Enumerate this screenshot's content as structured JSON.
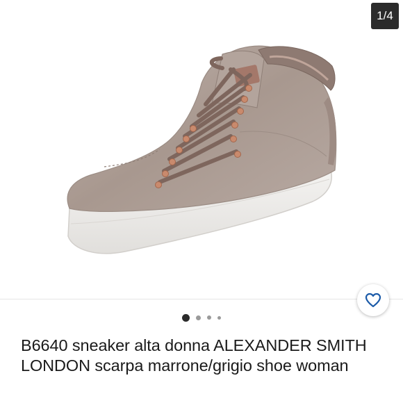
{
  "gallery": {
    "counter": "1/4",
    "dots_count": 4,
    "active_index": 0
  },
  "listing": {
    "title": "B6640 sneaker alta donna ALEXANDER SMITH LONDON scarpa marrone/grigio shoe woman"
  },
  "icons": {
    "like": "heart-icon"
  },
  "colors": {
    "accent": "#1a5aa8",
    "counter_bg": "#2b2b2b",
    "dot_active": "#2b2b2b",
    "dot_inactive": "#9a9a9a"
  }
}
